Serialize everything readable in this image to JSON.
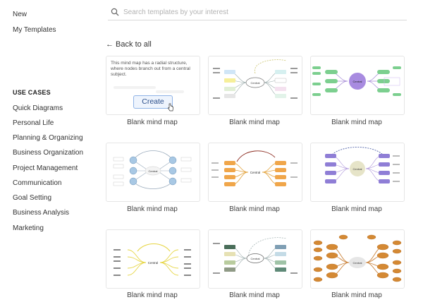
{
  "sidebar": {
    "top_links": [
      "New",
      "My Templates"
    ],
    "section_title": "USE CASES",
    "items": [
      "Quick Diagrams",
      "Personal Life",
      "Planning & Organizing",
      "Business Organization",
      "Project Management",
      "Communication",
      "Goal Setting",
      "Business Analysis",
      "Marketing"
    ]
  },
  "search": {
    "placeholder": "Search templates by your interest",
    "value": ""
  },
  "back_link": "← Back to all",
  "preview_card": {
    "description": "This mind map has a radial structure, where nodes branch out from a central subject.",
    "create_label": "Create"
  },
  "templates": [
    {
      "label": "Blank mind map"
    },
    {
      "label": "Blank mind map"
    },
    {
      "label": "Blank mind map"
    },
    {
      "label": "Blank mind map"
    },
    {
      "label": "Blank mind map"
    },
    {
      "label": "Blank mind map"
    },
    {
      "label": "Blank mind map"
    },
    {
      "label": "Blank mind map"
    },
    {
      "label": "Blank mind map"
    }
  ],
  "map_text": {
    "central": "Central",
    "level": "Level 1",
    "small": "Level 1"
  },
  "colors": {
    "accent": "#8fb3e6",
    "text": "#333333"
  }
}
